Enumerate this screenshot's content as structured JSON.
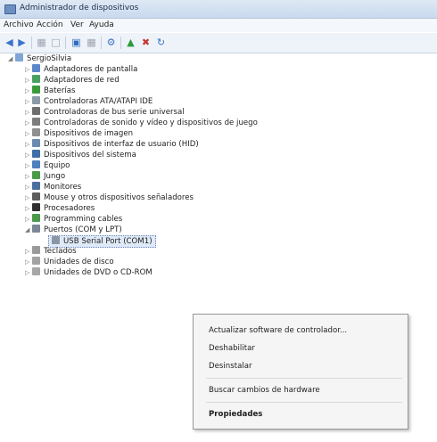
{
  "window": {
    "title": "Administrador de dispositivos"
  },
  "menu": [
    "Archivo",
    "Acción",
    "Ver",
    "Ayuda"
  ],
  "toolbar": {
    "icons": [
      "back-arrow-icon",
      "forward-arrow-icon",
      "grid-icon",
      "window-icon",
      "properties-icon",
      "grid-icon",
      "scan-icon",
      "update-icon",
      "disable-icon",
      "uninstall-icon"
    ]
  },
  "tree": {
    "root": "SergioSilvia",
    "items": [
      "Adaptadores de pantalla",
      "Adaptadores de red",
      "Baterías",
      "Controladoras ATA/ATAPI IDE",
      "Controladoras de bus serie universal",
      "Controladoras de sonido y vídeo y dispositivos de juego",
      "Dispositivos de imagen",
      "Dispositivos de interfaz de usuario (HID)",
      "Dispositivos del sistema",
      "Equipo",
      "Jungo",
      "Monitores",
      "Mouse y otros dispositivos señaladores",
      "Procesadores",
      "Programming cables",
      "Puertos (COM y LPT)",
      "USB Serial Port (COM1)",
      "Teclados",
      "Unidades de disco",
      "Unidades de DVD o CD-ROM"
    ]
  },
  "context_menu": {
    "items": [
      "Actualizar software de controlador...",
      "Deshabilitar",
      "Desinstalar",
      "Buscar cambios de hardware",
      "Propiedades"
    ]
  },
  "colors": {
    "accent": "#6a86b8",
    "selection": "#dfe9f7"
  }
}
